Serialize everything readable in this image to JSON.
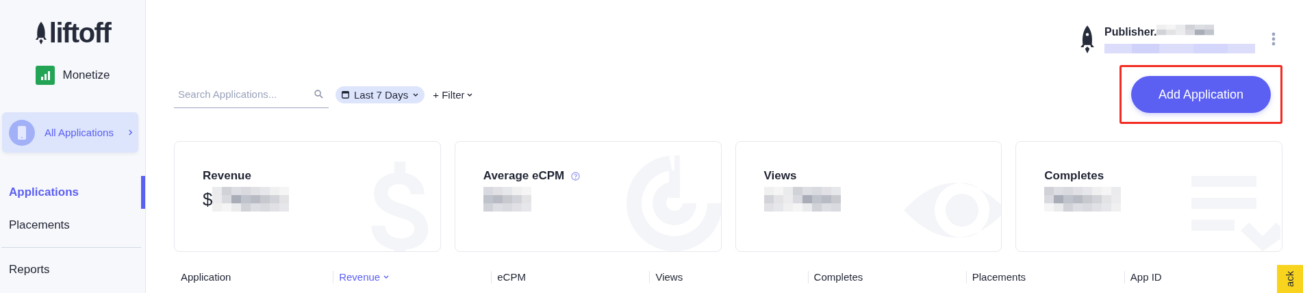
{
  "sidebar": {
    "logo": {
      "text": "liftoff"
    },
    "product": {
      "label": "Monetize"
    },
    "app_switcher": {
      "label": "All Applications"
    },
    "nav_sections": [
      {
        "items": [
          {
            "label": "Applications",
            "selected": true
          },
          {
            "label": "Placements",
            "selected": false
          }
        ]
      },
      {
        "items": [
          {
            "label": "Reports",
            "selected": false
          }
        ]
      }
    ]
  },
  "account": {
    "name": "Publisher."
  },
  "toolbar": {
    "search": {
      "placeholder": "Search Applications..."
    },
    "date_range": {
      "label": "Last 7 Days"
    },
    "filter": {
      "label": "+ Filter"
    }
  },
  "add_button": {
    "label": "Add Application",
    "highlighted": true
  },
  "stats": [
    {
      "title": "Revenue",
      "prefix": "$",
      "kind": "dollar",
      "help": false
    },
    {
      "title": "Average eCPM",
      "kind": "target",
      "help": true
    },
    {
      "title": "Views",
      "kind": "eye",
      "help": false
    },
    {
      "title": "Completes",
      "kind": "checklist",
      "help": false
    }
  ],
  "table": {
    "columns": [
      {
        "label": "Application",
        "sorted": false
      },
      {
        "label": "Revenue",
        "sorted": true
      },
      {
        "label": "eCPM",
        "sorted": false
      },
      {
        "label": "Views",
        "sorted": false
      },
      {
        "label": "Completes",
        "sorted": false
      },
      {
        "label": "Placements",
        "sorted": false
      },
      {
        "label": "App ID",
        "sorted": false
      }
    ]
  },
  "feedback_tab": {
    "label": "ack"
  }
}
